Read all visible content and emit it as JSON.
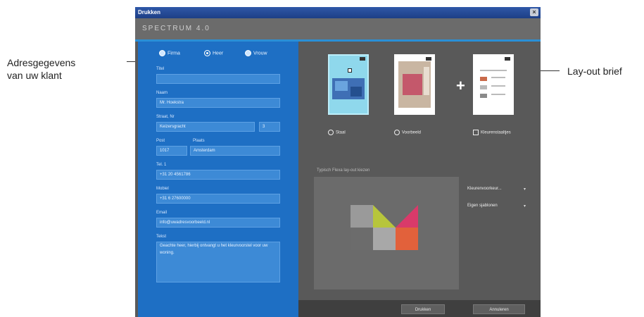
{
  "callouts": {
    "left_line1": "Adresgegevens",
    "left_line2": "van uw klant",
    "right": "Lay-out brief"
  },
  "window": {
    "title": "Drukken",
    "close_glyph": "×",
    "brand": "SPECTRUM 4.0"
  },
  "form": {
    "radios": [
      {
        "label": "Firma",
        "selected": false
      },
      {
        "label": "Heer",
        "selected": true
      },
      {
        "label": "Vrouw",
        "selected": false
      }
    ],
    "fields": [
      {
        "label": "Titel",
        "value": ""
      },
      {
        "label": "Naam",
        "value": "Mr. Hoekstra"
      },
      {
        "label": "Straat, Nr",
        "value": "Keizersgracht",
        "nr": "3"
      },
      {
        "label": "Post",
        "label2": "Plaats",
        "value": "1017",
        "value2": "Amsterdam"
      },
      {
        "label": "Tel. 1",
        "value": "+31 20 4561786"
      },
      {
        "label": "Mobiel",
        "value": "+31 6 27600000"
      },
      {
        "label": "Email",
        "value": "info@uwadresvoorbeeld.nl"
      },
      {
        "label": "Tekst",
        "value": "Geachte heer, hierbij ontvangt u het kleurvoorstel voor uw woning."
      }
    ]
  },
  "layout": {
    "options": [
      {
        "label": "Staal",
        "type": "radio"
      },
      {
        "label": "Voorbeeld",
        "type": "radio"
      },
      {
        "label": "Kleurenstaaltjes",
        "type": "checkbox"
      }
    ],
    "preview_label": "Typisch Flexa lay-out kiezen",
    "side_links": [
      "Kleurenvoorkeur...",
      "Eigen sjablonen"
    ],
    "buttons": {
      "print": "Drukken",
      "cancel": "Annuleren"
    },
    "logo_colors": [
      "#9a9a9a",
      "#b7c53c",
      "#d93a6a",
      "#6c6c6c",
      "#a8a8a8",
      "#e2613b"
    ]
  }
}
